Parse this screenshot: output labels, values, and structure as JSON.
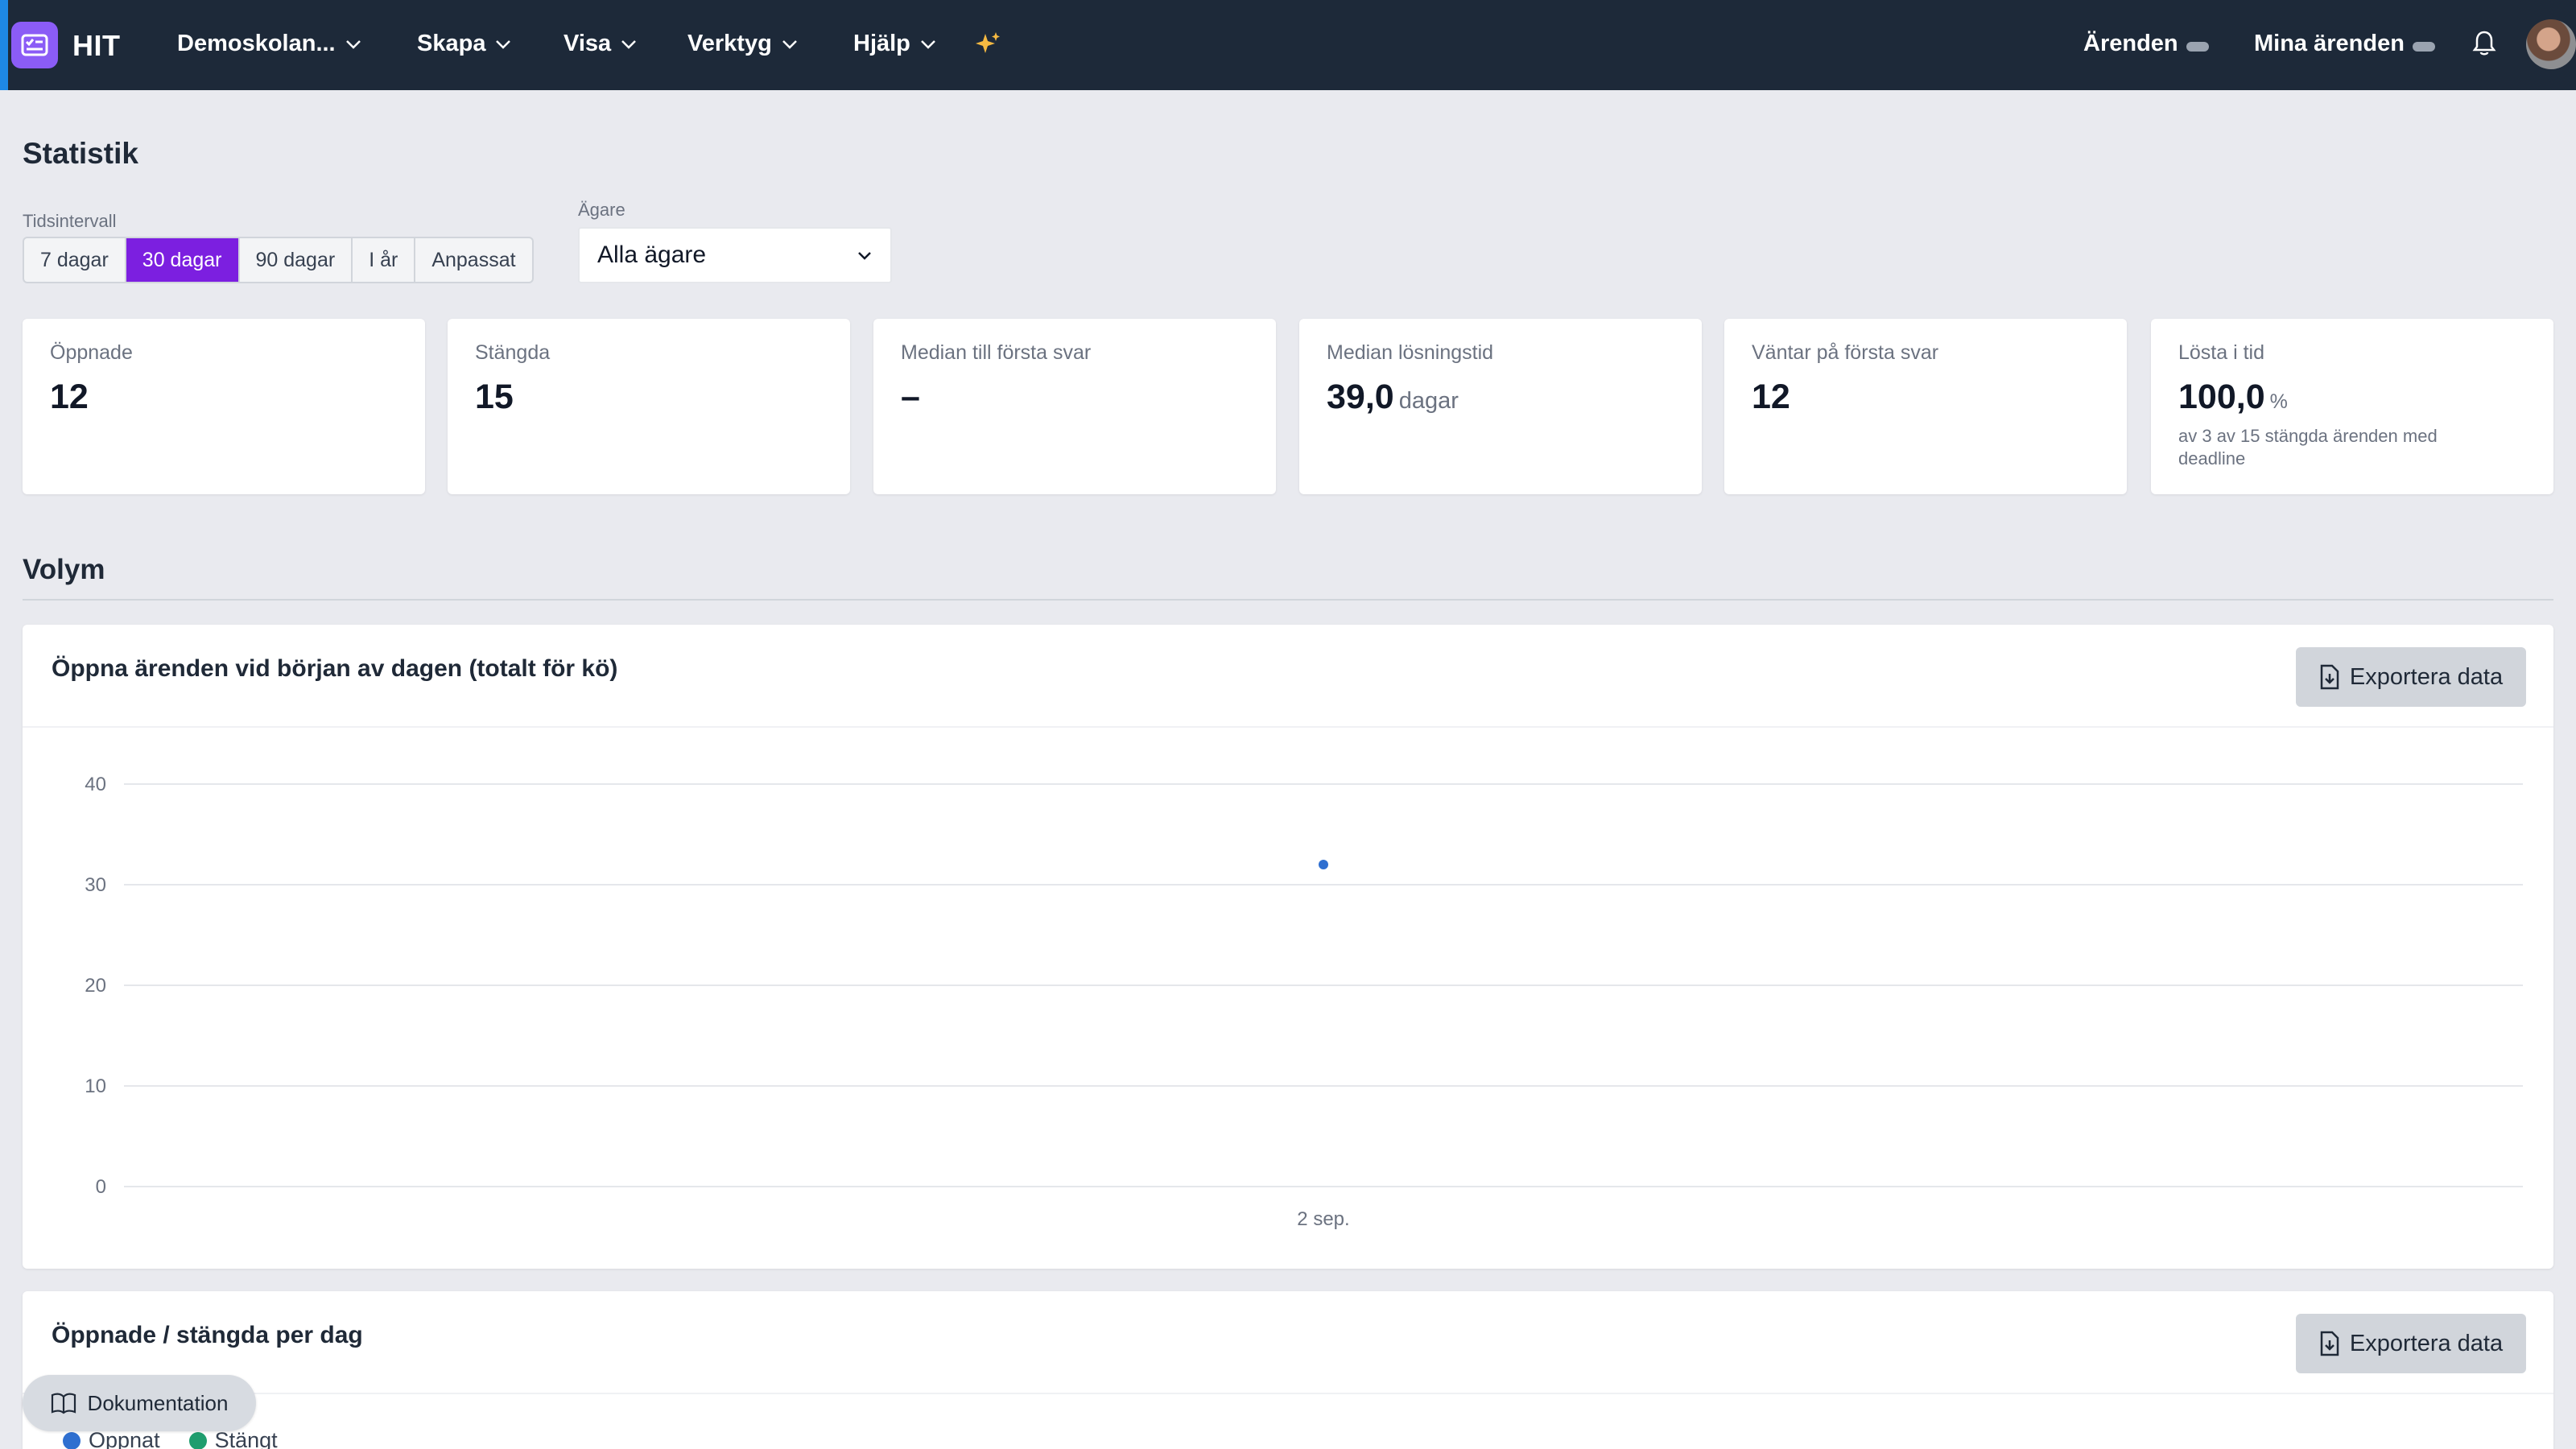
{
  "app": {
    "name": "HIT",
    "accent": "#8b5cf6",
    "topbar_color": "#1d2939"
  },
  "nav": {
    "items": [
      {
        "label": "Demoskolan...",
        "icon": "chevron-down-icon"
      },
      {
        "label": "Skapa",
        "icon": "chevron-down-icon"
      },
      {
        "label": "Visa",
        "icon": "chevron-down-icon"
      },
      {
        "label": "Verktyg",
        "icon": "chevron-down-icon"
      },
      {
        "label": "Hjälp",
        "icon": "chevron-down-icon"
      }
    ],
    "ai_icon": "sparkles-icon",
    "right": {
      "arenden": "Ärenden",
      "mina_arenden": "Mina ärenden"
    },
    "notifications_icon": "bell-icon"
  },
  "page": {
    "title": "Statistik",
    "interval_label": "Tidsintervall",
    "intervals": [
      "7 dagar",
      "30 dagar",
      "90 dagar",
      "I år",
      "Anpassat"
    ],
    "selected_interval": "30 dagar",
    "owner_label": "Ägare",
    "owner_value": "Alla ägare"
  },
  "stats": [
    {
      "label": "Öppnade",
      "value": "12"
    },
    {
      "label": "Stängda",
      "value": "15"
    },
    {
      "label": "Median till första svar",
      "value": "–"
    },
    {
      "label": "Median lösningstid",
      "value": "39,0",
      "unit": "dagar"
    },
    {
      "label": "Väntar på första svar",
      "value": "12"
    },
    {
      "label": "Lösta i tid",
      "value": "100,0",
      "unit": "%",
      "sub": "av 3 av 15 stängda ärenden med deadline"
    }
  ],
  "volume": {
    "section_title": "Volym",
    "panel1": {
      "title": "Öppna ärenden vid början av dagen (totalt för kö)",
      "export_label": "Exportera data"
    },
    "panel2": {
      "title": "Öppnade / stängda per dag",
      "export_label": "Exportera data",
      "legend": [
        {
          "label": "Öppnat",
          "color": "#2f6fd0"
        },
        {
          "label": "Stängt",
          "color": "#1f9d6e"
        }
      ]
    }
  },
  "chart_data": {
    "type": "line",
    "title": "Öppna ärenden vid början av dagen (totalt för kö)",
    "x": [
      "2 sep."
    ],
    "series": [
      {
        "values": [
          32
        ],
        "color": "#2f6fd0"
      }
    ],
    "yticks": [
      0,
      10,
      20,
      30,
      40
    ],
    "ylim": [
      0,
      40
    ],
    "xlabel": "",
    "ylabel": "",
    "grid": true
  },
  "footer": {
    "doc_label": "Dokumentation"
  }
}
